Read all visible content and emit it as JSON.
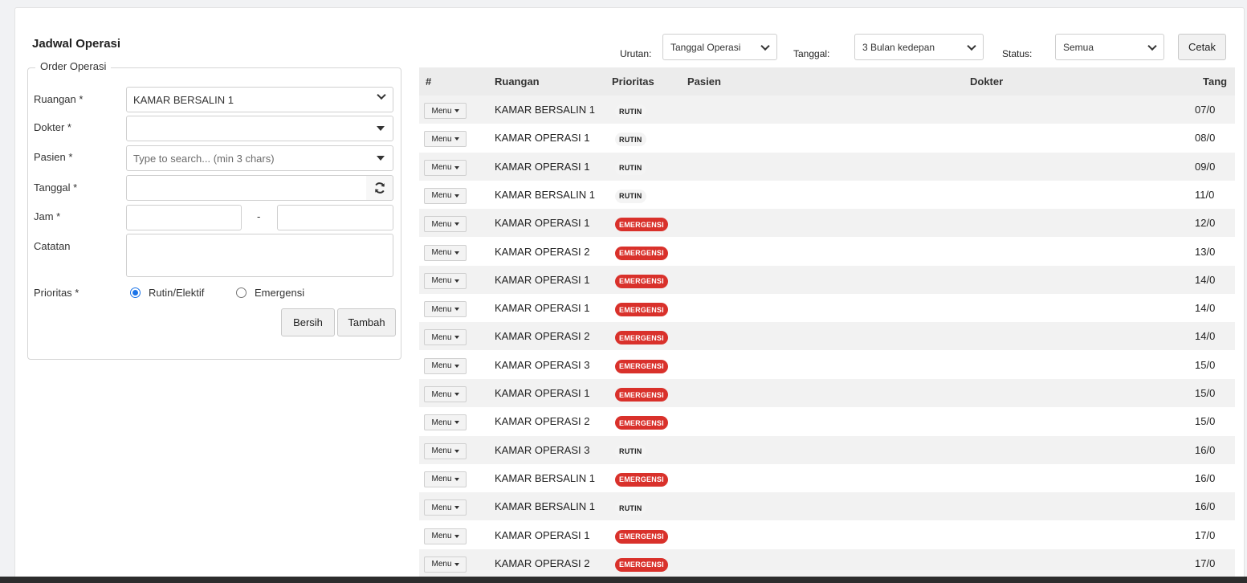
{
  "page_title": "Jadwal Operasi",
  "form": {
    "legend": "Order Operasi",
    "ruangan_label": "Ruangan *",
    "ruangan_value": "KAMAR BERSALIN 1",
    "dokter_label": "Dokter *",
    "dokter_value": "",
    "pasien_label": "Pasien *",
    "pasien_placeholder": "Type to search... (min 3 chars)",
    "tanggal_label": "Tanggal *",
    "tanggal_value": "",
    "refresh_icon": "refresh-icon",
    "jam_label": "Jam *",
    "jam_separator": "-",
    "catatan_label": "Catatan",
    "prioritas_label": "Prioritas *",
    "prioritas_options": [
      "Rutin/Elektif",
      "Emergensi"
    ],
    "prioritas_selected": "Rutin/Elektif",
    "clear_button": "Bersih",
    "add_button": "Tambah"
  },
  "filters": {
    "urutan_label": "Urutan:",
    "urutan_value": "Tanggal Operasi",
    "tanggal_label": "Tanggal:",
    "tanggal_value": "3 Bulan kedepan",
    "status_label": "Status:",
    "status_value": "Semua",
    "print_button": "Cetak"
  },
  "table": {
    "headers": [
      "#",
      "Ruangan",
      "Prioritas",
      "Pasien",
      "Dokter",
      "Tang"
    ],
    "menu_label": "Menu",
    "rows": [
      {
        "room": "KAMAR BERSALIN 1",
        "priority": "RUTIN",
        "date": "07/0"
      },
      {
        "room": "KAMAR OPERASI 1",
        "priority": "RUTIN",
        "date": "08/0"
      },
      {
        "room": "KAMAR OPERASI 1",
        "priority": "RUTIN",
        "date": "09/0"
      },
      {
        "room": "KAMAR BERSALIN 1",
        "priority": "RUTIN",
        "date": "11/0"
      },
      {
        "room": "KAMAR OPERASI 1",
        "priority": "EMERGENSI",
        "date": "12/0"
      },
      {
        "room": "KAMAR OPERASI 2",
        "priority": "EMERGENSI",
        "date": "13/0"
      },
      {
        "room": "KAMAR OPERASI 1",
        "priority": "EMERGENSI",
        "date": "14/0"
      },
      {
        "room": "KAMAR OPERASI 1",
        "priority": "EMERGENSI",
        "date": "14/0"
      },
      {
        "room": "KAMAR OPERASI 2",
        "priority": "EMERGENSI",
        "date": "14/0"
      },
      {
        "room": "KAMAR OPERASI 3",
        "priority": "EMERGENSI",
        "date": "15/0"
      },
      {
        "room": "KAMAR OPERASI 1",
        "priority": "EMERGENSI",
        "date": "15/0"
      },
      {
        "room": "KAMAR OPERASI 2",
        "priority": "EMERGENSI",
        "date": "15/0"
      },
      {
        "room": "KAMAR OPERASI 3",
        "priority": "RUTIN",
        "date": "16/0"
      },
      {
        "room": "KAMAR BERSALIN 1",
        "priority": "EMERGENSI",
        "date": "16/0"
      },
      {
        "room": "KAMAR BERSALIN 1",
        "priority": "RUTIN",
        "date": "16/0"
      },
      {
        "room": "KAMAR OPERASI 1",
        "priority": "EMERGENSI",
        "date": "17/0"
      },
      {
        "room": "KAMAR OPERASI 2",
        "priority": "EMERGENSI",
        "date": "17/0"
      }
    ]
  },
  "colors": {
    "emergensi": "#d9312b",
    "rutin": "#f4f4f4",
    "radio_accent": "#1a73e8"
  }
}
